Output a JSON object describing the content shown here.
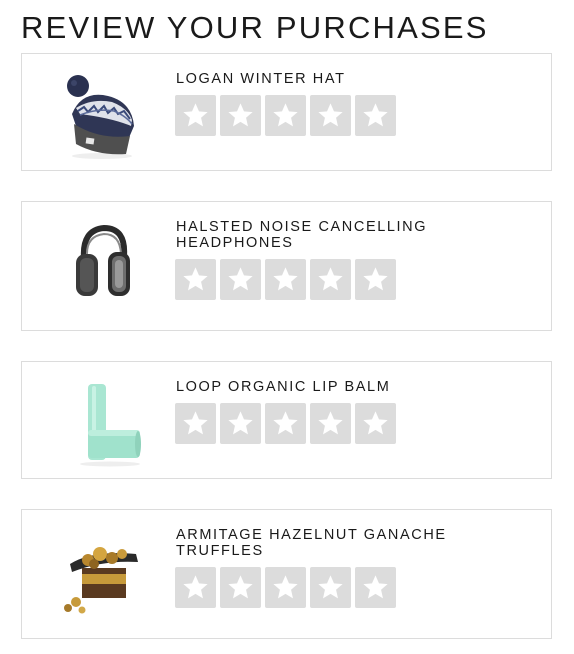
{
  "page": {
    "title": "REVIEW YOUR PURCHASES"
  },
  "products": [
    {
      "name": "LOGAN WINTER HAT",
      "image": "winter-hat-image",
      "rating": 0,
      "max_rating": 5
    },
    {
      "name": "HALSTED NOISE CANCELLING HEADPHONES",
      "image": "headphones-image",
      "rating": 0,
      "max_rating": 5
    },
    {
      "name": "LOOP ORGANIC LIP BALM",
      "image": "lip-balm-image",
      "rating": 0,
      "max_rating": 5
    },
    {
      "name": "ARMITAGE HAZELNUT GANACHE TRUFFLES",
      "image": "truffles-image",
      "rating": 0,
      "max_rating": 5
    }
  ],
  "colors": {
    "star_tile": "#dcdcdc",
    "star_glyph": "#ffffff",
    "card_border": "#dcdcdc"
  },
  "icons": {
    "star": "star-icon"
  }
}
